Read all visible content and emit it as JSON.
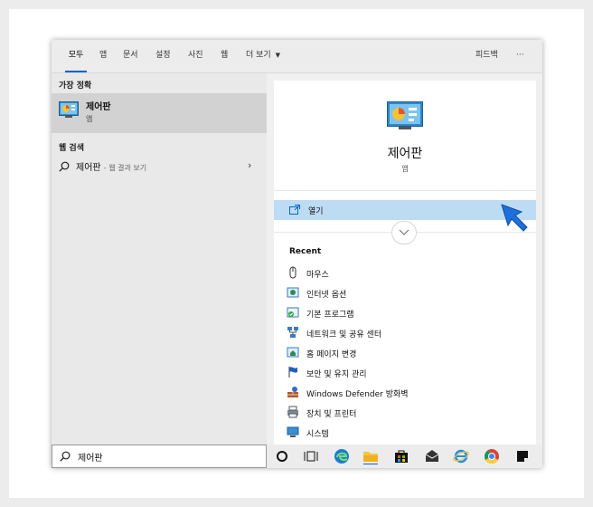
{
  "tabs": {
    "all": "모두",
    "apps": "앱",
    "documents": "문서",
    "settings": "설정",
    "photos": "사진",
    "web": "웹",
    "more": "더 보기",
    "feedback": "피드백",
    "ellipsis": "···"
  },
  "left": {
    "best_match_heading": "가장 정확",
    "best_match_title": "제어판",
    "best_match_sub": "앱",
    "web_heading": "웹 검색",
    "web_query": "제어판",
    "web_suffix": "- 웹 결과 보기"
  },
  "detail": {
    "app_name": "제어판",
    "app_type": "앱",
    "open_label": "열기",
    "recent_heading": "Recent",
    "recent": [
      {
        "label": "마우스",
        "icon": "mouse-icon"
      },
      {
        "label": "인터넷 옵션",
        "icon": "internet-options-icon"
      },
      {
        "label": "기본 프로그램",
        "icon": "default-programs-icon"
      },
      {
        "label": "네트워크 및 공유 센터",
        "icon": "network-center-icon"
      },
      {
        "label": "홈 페이지 변경",
        "icon": "homepage-icon"
      },
      {
        "label": "보안 및 유지 관리",
        "icon": "flag-icon"
      },
      {
        "label": "Windows Defender 방화벽",
        "icon": "firewall-icon"
      },
      {
        "label": "장치 및 프린터",
        "icon": "printer-icon"
      },
      {
        "label": "시스템",
        "icon": "system-icon"
      }
    ]
  },
  "search": {
    "value": "제어판"
  },
  "colors": {
    "accent": "#0a64c2",
    "selection": "#bcdcf4",
    "cursor": "#1e6fd9"
  }
}
